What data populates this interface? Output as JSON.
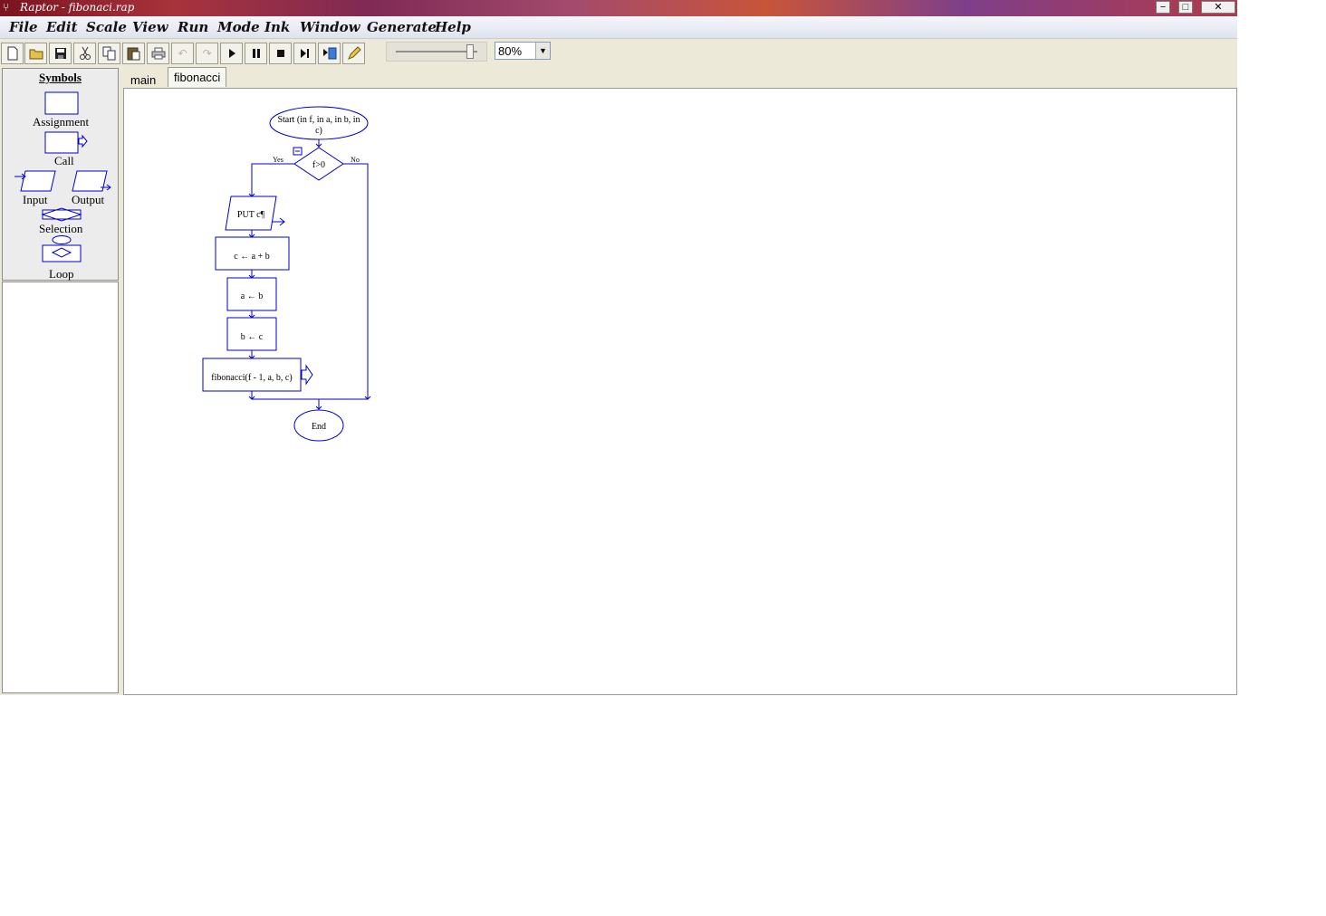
{
  "window": {
    "title": "Raptor - fibonaci.rap",
    "app_icon": "raptor-icon",
    "controls": [
      "minimize",
      "maximize",
      "close"
    ]
  },
  "menu": [
    "File",
    "Edit",
    "Scale",
    "View",
    "Run",
    "Mode",
    "Ink",
    "Window",
    "Generate",
    "Help"
  ],
  "toolbar": {
    "buttons": [
      "new",
      "open",
      "save",
      "cut",
      "copy",
      "paste",
      "print",
      "undo",
      "redo",
      "execute",
      "pause",
      "stop",
      "step",
      "test-server",
      "ink-pen"
    ],
    "zoom_value": "80%"
  },
  "symbols": {
    "title": "Symbols",
    "items": [
      "Assignment",
      "Call",
      "Input",
      "Output",
      "Selection",
      "Loop"
    ]
  },
  "tabs": [
    {
      "label": "main",
      "active": false
    },
    {
      "label": "fibonacci",
      "active": true
    }
  ],
  "flowchart": {
    "start_line1": "Start (in f, in a, in b, in",
    "start_line2": "c)",
    "decision": "f>0",
    "yes_label": "Yes",
    "no_label": "No",
    "output": "PUT c¶",
    "assign1": "c ← a + b",
    "assign2": "a ← b",
    "assign3": "b ← c",
    "call": "fibonacci(f - 1, a, b, c)",
    "end": "End",
    "stroke_color": "#0000cc"
  }
}
